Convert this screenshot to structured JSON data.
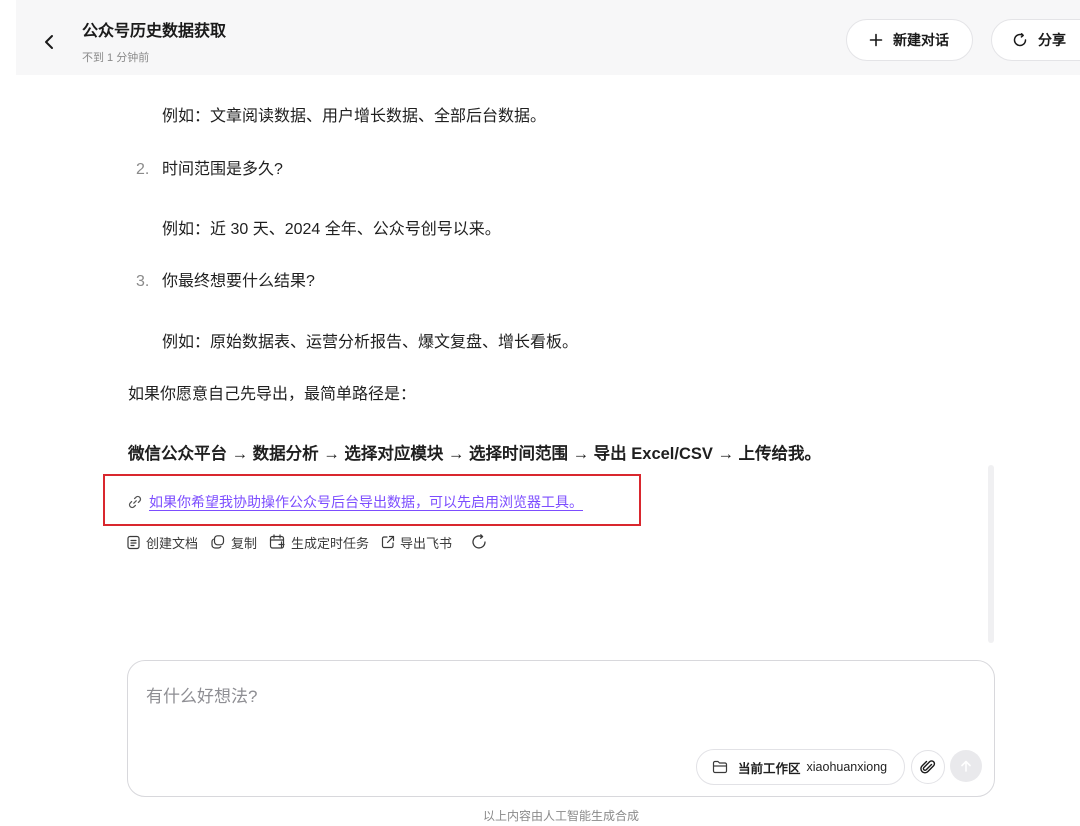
{
  "header": {
    "title": "公众号历史数据获取",
    "subtitle": "不到 1 分钟前",
    "new_chat_label": "新建对话",
    "share_label": "分享"
  },
  "content": {
    "example_1": "例如：文章阅读数据、用户增长数据、全部后台数据。",
    "q2_number": "2.",
    "q2_text": "时间范围是多久?",
    "example_2": "例如：近 30 天、2024 全年、公众号创号以来。",
    "q3_number": "3.",
    "q3_text": "你最终想要什么结果?",
    "example_3": "例如：原始数据表、运营分析报告、爆文复盘、增长看板。",
    "export_intro": "如果你愿意自己先导出，最简单路径是：",
    "export_path": "微信公众平台 → 数据分析 → 选择对应模块 → 选择时间范围 → 导出 Excel/CSV → 上传给我。",
    "browser_link": "如果你希望我协助操作公众号后台导出数据，可以先启用浏览器工具。"
  },
  "actions": [
    {
      "label": "创建文档",
      "icon": "document-icon"
    },
    {
      "label": "复制",
      "icon": "copy-icon"
    },
    {
      "label": "生成定时任务",
      "icon": "calendar-task-icon"
    },
    {
      "label": "导出飞书",
      "icon": "export-icon"
    }
  ],
  "composer": {
    "placeholder": "有什么好想法?",
    "workspace_label": "当前工作区",
    "workspace_value": "xiaohuanxiong"
  },
  "footer": {
    "note": "以上内容由人工智能生成合成"
  },
  "colors": {
    "link": "#7c4dff",
    "highlight_border": "#d9272e",
    "header_bg": "#f7f7f8"
  }
}
